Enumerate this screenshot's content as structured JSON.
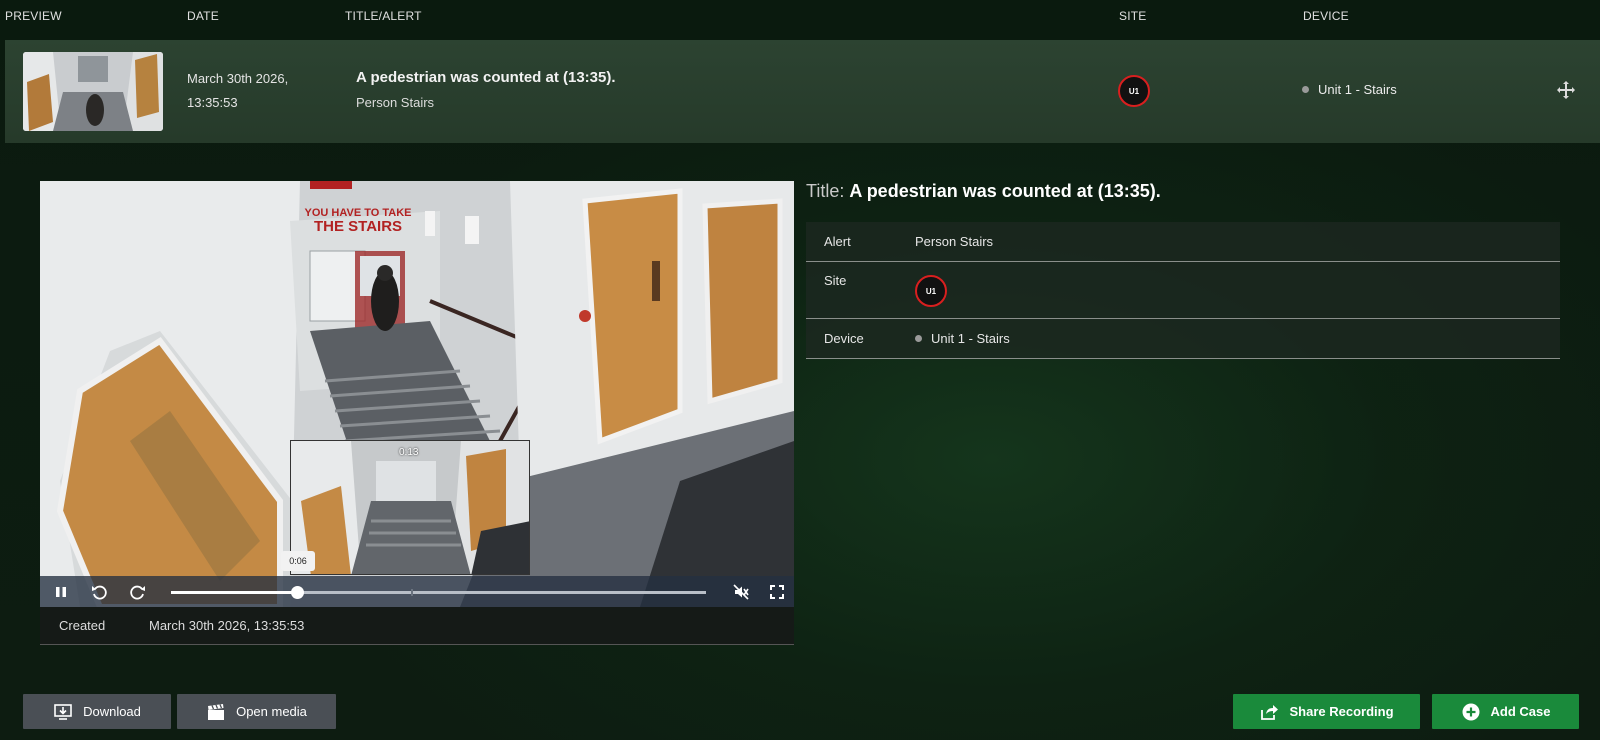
{
  "columns": {
    "preview": "PREVIEW",
    "date": "DATE",
    "title_alert": "TITLE/ALERT",
    "site": "SITE",
    "device": "DEVICE"
  },
  "event": {
    "date_line1": "March 30th 2026,",
    "date_line2": "13:35:53",
    "title": "A pedestrian was counted at (13:35).",
    "alert": "Person Stairs",
    "site_badge": "U1",
    "device": "Unit 1 - Stairs"
  },
  "player": {
    "scene_sign_line1": "YOU HAVE TO TAKE",
    "scene_sign_line2": "THE STAIRS",
    "preview_time": "0:13",
    "current_time": "0:06",
    "progress": 0.235,
    "muted": true
  },
  "created": {
    "label": "Created",
    "value": "March 30th 2026, 13:35:53"
  },
  "details": {
    "title_key": "Title:",
    "title_value": "A pedestrian was counted at (13:35).",
    "rows": [
      {
        "key": "Alert",
        "value": "Person Stairs"
      },
      {
        "key": "Site",
        "value": "U1"
      },
      {
        "key": "Device",
        "value": "Unit 1 - Stairs"
      }
    ]
  },
  "actions": {
    "download": "Download",
    "open_media": "Open media",
    "share_recording": "Share Recording",
    "add_case": "Add Case"
  },
  "colors": {
    "accent_green": "#1a8a3b",
    "site_ring": "#d91f1f"
  }
}
